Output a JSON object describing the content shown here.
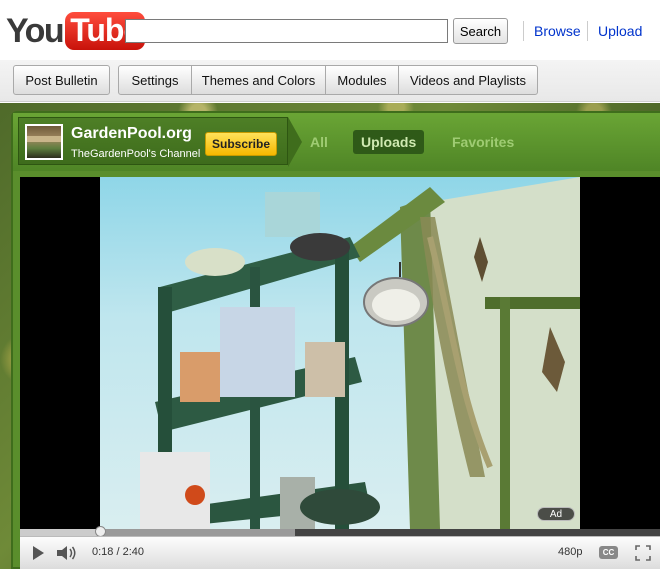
{
  "header": {
    "logo": {
      "you": "You",
      "tube": "Tube"
    },
    "search": {
      "value": "",
      "placeholder": "",
      "button_label": "Search"
    },
    "links": {
      "browse": "Browse",
      "upload": "Upload"
    }
  },
  "toolbar": {
    "buttons": [
      "Post Bulletin",
      "Settings",
      "Themes and Colors",
      "Modules",
      "Videos and Playlists"
    ]
  },
  "channel": {
    "name": "GardenPool.org",
    "subtitle": "TheGardenPool's Channel",
    "subscribe_label": "Subscribe",
    "tabs": [
      {
        "label": "All",
        "active": false
      },
      {
        "label": "Uploads",
        "active": true
      },
      {
        "label": "Favorites",
        "active": false
      }
    ],
    "accent_color": "#5a8e2c"
  },
  "player": {
    "current_time": "0:18",
    "duration": "2:40",
    "time_display": "0:18 / 2:40",
    "quality": "480p",
    "cc_label": "CC",
    "ad_label": "Ad",
    "played_fraction": 0.125,
    "buffered_fraction": 0.43,
    "icons": [
      "play-icon",
      "volume-icon",
      "cc-icon",
      "fullscreen-icon"
    ]
  },
  "colors": {
    "link": "#0033cc",
    "subscribe": "#f5b800",
    "channel_green": "#5a8e2c"
  }
}
